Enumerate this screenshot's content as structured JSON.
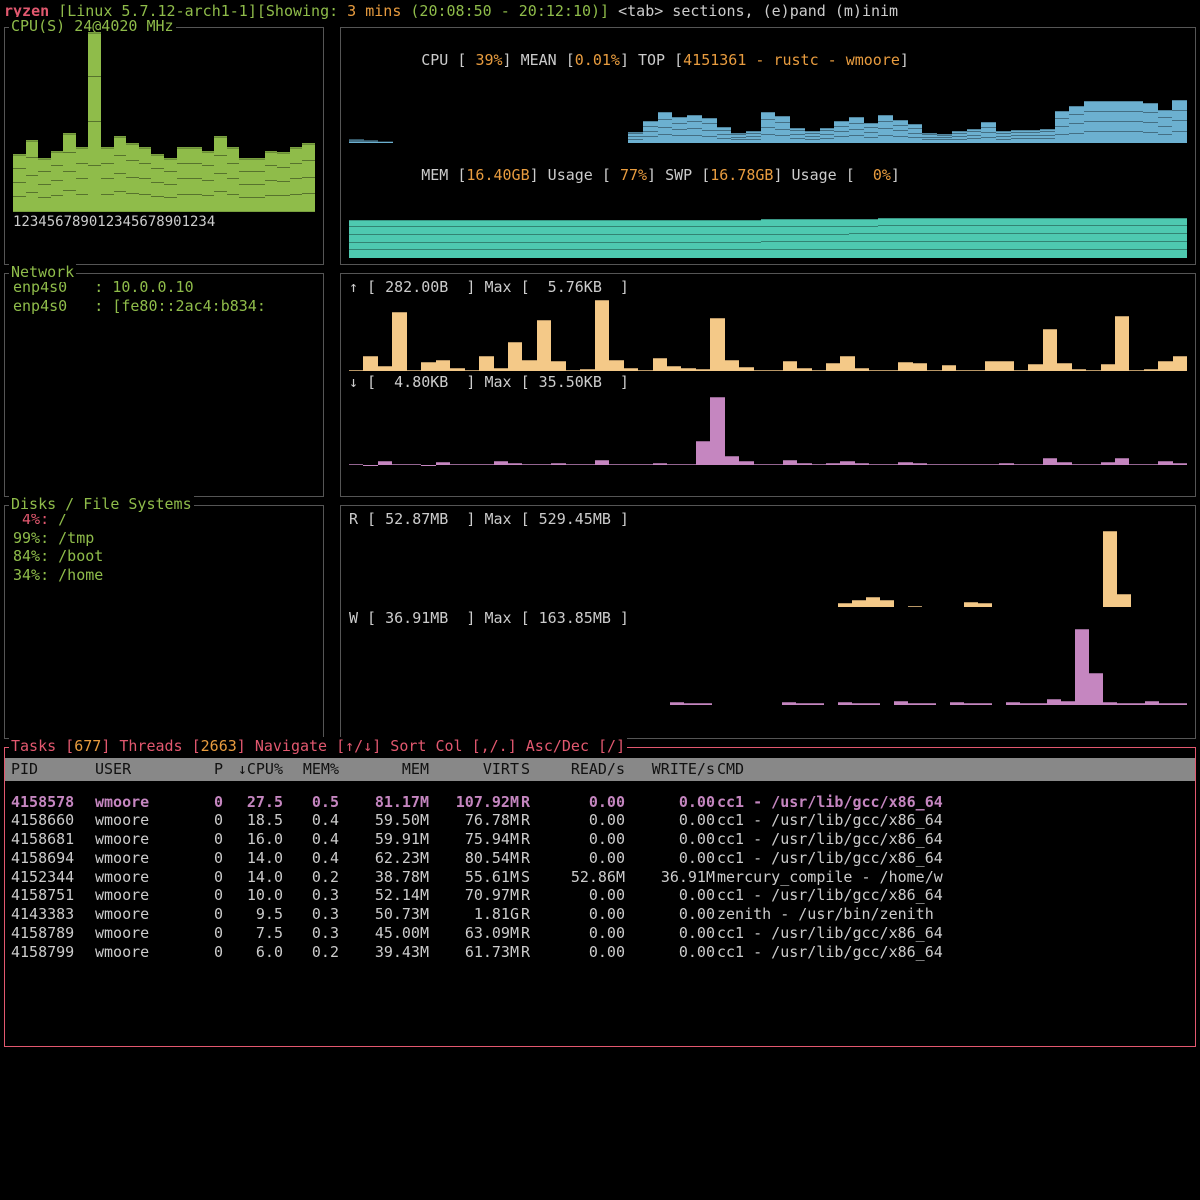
{
  "header": {
    "host": "ryzen",
    "kernel": "[Linux 5.7.12-arch1-1]",
    "showing_lbl": "[Showing:",
    "showing_val": " 3 mins",
    "timerange": " (20:08:50 - 20:12:10)]",
    "hints": " <tab> sections, (e)pand (m)inim"
  },
  "cpu_panel": {
    "title": "CPU(S) 24@4020 MHz",
    "axis": "123456789012345678901234",
    "summary_pre": "CPU [ ",
    "summary_pct": "39%",
    "summary_mid": "] MEAN [",
    "summary_mean": "0.01%",
    "summary_top": "] TOP [",
    "summary_topval": "4151361 - rustc - wmoore",
    "summary_end": "]",
    "mem_pre": "MEM [",
    "mem_val": "16.40GB",
    "mem_mid": "] Usage [ ",
    "mem_pct": "77%",
    "mem_swp": "] SWP [",
    "swp_val": "16.78GB",
    "swp_mid": "] Usage [  ",
    "swp_pct": "0%",
    "swp_end": "]"
  },
  "network_panel": {
    "title": "Network",
    "iface1": "enp4s0   : 10.0.0.10",
    "iface2": "enp4s0   : [fe80::2ac4:b834:",
    "up_line": "↑ [ 282.00B  ] Max [  5.76KB  ]",
    "down_line": "↓ [  4.80KB  ] Max [ 35.50KB  ]"
  },
  "disk_panel": {
    "title": "Disks / File Systems",
    "fs": [
      {
        "pct": "4%:",
        "path": " /",
        "cls": "red"
      },
      {
        "pct": "99%:",
        "path": " /tmp",
        "cls": "green"
      },
      {
        "pct": "84%:",
        "path": " /boot",
        "cls": "green"
      },
      {
        "pct": "34%:",
        "path": " /home",
        "cls": "green"
      }
    ],
    "r_line": "R [ 52.87MB  ] Max [ 529.45MB ]",
    "w_line": "W [ 36.91MB  ] Max [ 163.85MB ]"
  },
  "tasks": {
    "title_pre": "Tasks [",
    "tasks_n": "677",
    "title_mid": "] Threads [",
    "threads_n": "2663",
    "title_nav": "]  Navigate [↑/↓]  Sort Col [,/.] Asc/Dec [/]",
    "cols": [
      "PID",
      "USER",
      "P",
      "↓CPU%",
      "MEM%",
      "MEM",
      "VIRT",
      "S",
      "READ/s",
      "WRITE/s",
      "CMD"
    ],
    "rows": [
      {
        "pid": "4158578",
        "user": "wmoore",
        "p": "0",
        "cpu": "27.5",
        "memp": "0.5",
        "mem": "81.17M",
        "virt": "107.92M",
        "s": "R",
        "r": "0.00",
        "w": "0.00",
        "cmd": "cc1 - /usr/lib/gcc/x86_64",
        "sel": true
      },
      {
        "pid": "4158660",
        "user": "wmoore",
        "p": "0",
        "cpu": "18.5",
        "memp": "0.4",
        "mem": "59.50M",
        "virt": "76.78M",
        "s": "R",
        "r": "0.00",
        "w": "0.00",
        "cmd": "cc1 - /usr/lib/gcc/x86_64"
      },
      {
        "pid": "4158681",
        "user": "wmoore",
        "p": "0",
        "cpu": "16.0",
        "memp": "0.4",
        "mem": "59.91M",
        "virt": "75.94M",
        "s": "R",
        "r": "0.00",
        "w": "0.00",
        "cmd": "cc1 - /usr/lib/gcc/x86_64"
      },
      {
        "pid": "4158694",
        "user": "wmoore",
        "p": "0",
        "cpu": "14.0",
        "memp": "0.4",
        "mem": "62.23M",
        "virt": "80.54M",
        "s": "R",
        "r": "0.00",
        "w": "0.00",
        "cmd": "cc1 - /usr/lib/gcc/x86_64"
      },
      {
        "pid": "4152344",
        "user": "wmoore",
        "p": "0",
        "cpu": "14.0",
        "memp": "0.2",
        "mem": "38.78M",
        "virt": "55.61M",
        "s": "S",
        "r": "52.86M",
        "w": "36.91M",
        "cmd": "mercury_compile - /home/w"
      },
      {
        "pid": "4158751",
        "user": "wmoore",
        "p": "0",
        "cpu": "10.0",
        "memp": "0.3",
        "mem": "52.14M",
        "virt": "70.97M",
        "s": "R",
        "r": "0.00",
        "w": "0.00",
        "cmd": "cc1 - /usr/lib/gcc/x86_64"
      },
      {
        "pid": "4143383",
        "user": "wmoore",
        "p": "0",
        "cpu": "9.5",
        "memp": "0.3",
        "mem": "50.73M",
        "virt": "1.81G",
        "s": "R",
        "r": "0.00",
        "w": "0.00",
        "cmd": "zenith - /usr/bin/zenith"
      },
      {
        "pid": "4158789",
        "user": "wmoore",
        "p": "0",
        "cpu": "7.5",
        "memp": "0.3",
        "mem": "45.00M",
        "virt": "63.09M",
        "s": "R",
        "r": "0.00",
        "w": "0.00",
        "cmd": "cc1 - /usr/lib/gcc/x86_64"
      },
      {
        "pid": "4158799",
        "user": "wmoore",
        "p": "0",
        "cpu": "6.0",
        "memp": "0.2",
        "mem": "39.43M",
        "virt": "61.73M",
        "s": "R",
        "r": "0.00",
        "w": "0.00",
        "cmd": "cc1 - /usr/lib/gcc/x86_64"
      }
    ]
  },
  "chart_data": {
    "cpu_per_core": {
      "type": "bar",
      "categories_label": "cores 1-24",
      "values": [
        32,
        40,
        30,
        34,
        44,
        36,
        100,
        36,
        42,
        38,
        36,
        32,
        30,
        36,
        36,
        34,
        42,
        36,
        30,
        30,
        34,
        33,
        36,
        38
      ]
    },
    "cpu_usage_history": {
      "type": "area",
      "ylim": [
        0,
        100
      ],
      "values": [
        8,
        6,
        4,
        0,
        0,
        0,
        0,
        0,
        0,
        0,
        0,
        0,
        0,
        0,
        0,
        0,
        0,
        0,
        0,
        22,
        42,
        60,
        50,
        55,
        48,
        32,
        20,
        24,
        60,
        52,
        30,
        24,
        30,
        42,
        50,
        38,
        55,
        45,
        36,
        20,
        18,
        24,
        28,
        40,
        24,
        26,
        26,
        28,
        62,
        72,
        82,
        82,
        82,
        82,
        78,
        64,
        84
      ]
    },
    "mem_usage_history": {
      "type": "area",
      "ylim": [
        0,
        100
      ],
      "values": [
        75,
        75,
        75,
        75,
        75,
        75,
        75,
        75,
        75,
        75,
        75,
        75,
        75,
        75,
        75,
        75,
        75,
        75,
        75,
        75,
        75,
        75,
        75,
        75,
        75,
        75,
        75,
        75,
        76,
        76,
        76,
        76,
        76,
        76,
        77,
        77,
        78,
        78,
        78,
        78,
        78,
        78,
        78,
        78,
        78,
        78,
        78,
        78,
        78,
        78,
        78,
        78,
        78,
        78,
        78,
        78,
        78
      ]
    },
    "net_up": {
      "type": "bar",
      "unit": "B",
      "max": 5900,
      "values": [
        80,
        1200,
        400,
        4800,
        60,
        700,
        900,
        200,
        60,
        1200,
        180,
        2300,
        900,
        4100,
        800,
        60,
        140,
        5760,
        900,
        200,
        60,
        1000,
        400,
        200,
        100,
        4300,
        900,
        260,
        60,
        80,
        800,
        180,
        60,
        600,
        1200,
        200,
        60,
        60,
        700,
        640,
        60,
        420,
        60,
        80,
        800,
        780,
        60,
        500,
        3400,
        640,
        140,
        80,
        560,
        4500,
        60,
        140,
        800,
        1160
      ]
    },
    "net_down": {
      "type": "bar",
      "unit": "B",
      "max": 35500,
      "values": [
        400,
        200,
        2200,
        600,
        400,
        300,
        1600,
        500,
        400,
        800,
        2200,
        1200,
        500,
        400,
        1200,
        800,
        500,
        2800,
        700,
        400,
        400,
        1300,
        700,
        400,
        12000,
        33800,
        4800,
        2000,
        700,
        400,
        2500,
        900,
        400,
        1200,
        2200,
        900,
        400,
        400,
        1700,
        900,
        400,
        400,
        400,
        400,
        600,
        900,
        400,
        400,
        3600,
        1400,
        600,
        400,
        1500,
        3400,
        700,
        400,
        1900,
        900
      ]
    },
    "disk_read": {
      "type": "bar",
      "unit": "MB",
      "max": 529.45,
      "values": [
        0,
        0,
        0,
        0,
        0,
        0,
        0,
        0,
        0,
        0,
        0,
        0,
        0,
        0,
        0,
        0,
        0,
        0,
        0,
        0,
        0,
        0,
        0,
        0,
        0,
        0,
        0,
        0,
        0,
        0,
        0,
        0,
        0,
        0,
        0,
        22,
        42,
        66,
        48,
        0,
        2,
        0,
        0,
        0,
        30,
        24,
        0,
        0,
        0,
        0,
        0,
        0,
        0,
        0,
        529,
        90,
        0,
        0,
        0,
        0
      ]
    },
    "disk_write": {
      "type": "bar",
      "unit": "MB",
      "max": 163.85,
      "values": [
        0,
        0,
        0,
        0,
        0,
        0,
        0,
        0,
        0,
        0,
        0,
        0,
        0,
        0,
        0,
        0,
        0,
        0,
        0,
        0,
        0,
        0,
        0,
        6,
        4,
        4,
        0,
        0,
        0,
        0,
        0,
        8,
        4,
        4,
        0,
        8,
        4,
        4,
        0,
        10,
        4,
        4,
        0,
        8,
        4,
        4,
        0,
        8,
        4,
        4,
        14,
        10,
        164,
        70,
        6,
        4,
        4,
        10,
        4,
        4
      ]
    }
  }
}
